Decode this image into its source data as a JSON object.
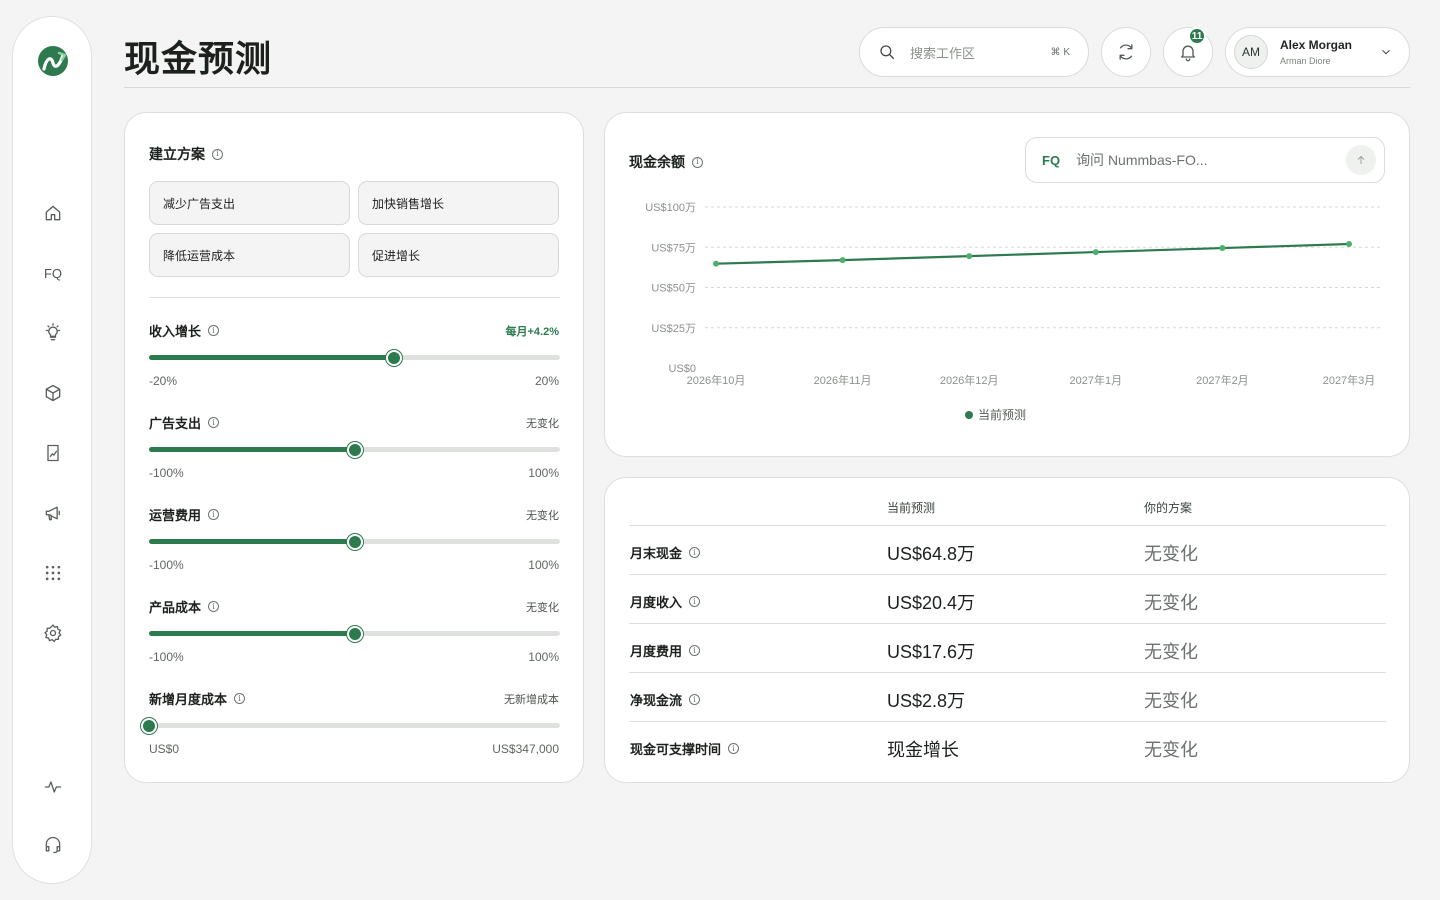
{
  "page": {
    "title": "现金预测"
  },
  "sidebar": {
    "items": [
      {
        "name": "home",
        "icon": "home-icon"
      },
      {
        "name": "fq",
        "icon": "fq-icon",
        "glyph": "FQ"
      },
      {
        "name": "insights",
        "icon": "lightbulb-icon"
      },
      {
        "name": "products",
        "icon": "cube-icon"
      },
      {
        "name": "reports",
        "icon": "document-chart-icon"
      },
      {
        "name": "marketing",
        "icon": "megaphone-icon"
      },
      {
        "name": "apps",
        "icon": "grid-dots-icon"
      },
      {
        "name": "settings",
        "icon": "gear-icon"
      },
      {
        "name": "activity",
        "icon": "activity-pulse-icon"
      },
      {
        "name": "support",
        "icon": "headset-icon"
      }
    ]
  },
  "header": {
    "search_placeholder": "搜索工作区",
    "search_shortcut": "⌘ K",
    "notifications_count": "11",
    "user": {
      "initials": "AM",
      "name": "Alex Morgan",
      "subtitle": "Arman Diore"
    }
  },
  "scenario": {
    "title": "建立方案",
    "presets": [
      "减少广告支出",
      "加快销售增长",
      "降低运营成本",
      "促进增长"
    ],
    "sliders": [
      {
        "label": "收入增长",
        "status": "每月+4.2%",
        "accent": true,
        "min": "-20%",
        "max": "20%",
        "level": 0.595
      },
      {
        "label": "广告支出",
        "status": "无变化",
        "accent": false,
        "min": "-100%",
        "max": "100%",
        "level": 0.5
      },
      {
        "label": "运营费用",
        "status": "无变化",
        "accent": false,
        "min": "-100%",
        "max": "100%",
        "level": 0.5
      },
      {
        "label": "产品成本",
        "status": "无变化",
        "accent": false,
        "min": "-100%",
        "max": "100%",
        "level": 0.5
      },
      {
        "label": "新增月度成本",
        "status": "无新增成本",
        "accent": false,
        "min": "US$0",
        "max": "US$347,000",
        "level": 0
      }
    ]
  },
  "cash_chart": {
    "title": "现金余额",
    "ask_glyph": "FQ",
    "ask_placeholder": "询问 Nummbas-FO..."
  },
  "chart_data": {
    "type": "line",
    "categories": [
      "2026年10月",
      "2026年11月",
      "2026年12月",
      "2027年1月",
      "2027年2月",
      "2027年3月"
    ],
    "series": [
      {
        "name": "当前预测",
        "values": [
          64.8,
          67.0,
          69.5,
          72.0,
          74.5,
          77.0
        ]
      }
    ],
    "yticks": [
      0,
      25,
      50,
      75,
      100
    ],
    "ytick_labels": [
      "US$0",
      "US$25万",
      "US$50万",
      "US$75万",
      "US$100万"
    ],
    "ylim": [
      0,
      100
    ],
    "grid": true,
    "legend": "bottom",
    "color": "#2d7a4f"
  },
  "table": {
    "headers": [
      "当前预测",
      "你的方案"
    ],
    "rows": [
      {
        "label": "月末现金",
        "current": "US$64.8万",
        "scenario": "无变化"
      },
      {
        "label": "月度收入",
        "current": "US$20.4万",
        "scenario": "无变化"
      },
      {
        "label": "月度费用",
        "current": "US$17.6万",
        "scenario": "无变化"
      },
      {
        "label": "净现金流",
        "current": "US$2.8万",
        "scenario": "无变化"
      },
      {
        "label": "现金可支撑时间",
        "current": "现金增长",
        "scenario": "无变化"
      }
    ]
  },
  "colors": {
    "accent": "#2d7a4f",
    "background": "#f3f4f3",
    "card": "#ffffff"
  }
}
